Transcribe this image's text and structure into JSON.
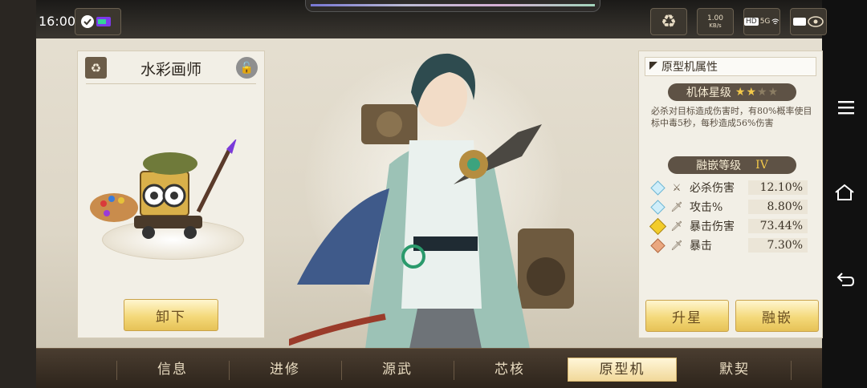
{
  "status": {
    "time": "16:00",
    "speed_value": "1.00",
    "speed_unit": "KB/s",
    "hd": "HD",
    "net": "5G"
  },
  "colors": {
    "accent_gold": "#f4d97a",
    "panel_bg": "#f2efe6",
    "bar_bg": "#2d241b",
    "gem_blue": "#bfe7f5",
    "gem_gold": "#f2cc2a",
    "gem_orange": "#e8a07a"
  },
  "left_panel": {
    "title": "水彩画师",
    "unequip_label": "卸下"
  },
  "right_panel": {
    "header": "原型机属性",
    "star_label": "机体星级",
    "stars": {
      "filled": 2,
      "total": 4
    },
    "skill_desc": "必杀对目标造成伤害时，有80%概率使目标中毒5秒，每秒造成56%伤害",
    "inlay_label": "融嵌等级",
    "inlay_level": "IV",
    "attributes": [
      {
        "icon": "swords-icon",
        "gem": "blue",
        "name": "必杀伤害",
        "value": "12.10%"
      },
      {
        "icon": "sword-icon",
        "gem": "blue",
        "name": "攻击%",
        "value": "8.80%"
      },
      {
        "icon": "crit-sword-icon",
        "gem": "gold",
        "name": "暴击伤害",
        "value": "73.44%"
      },
      {
        "icon": "crit-sword-icon",
        "gem": "orange",
        "name": "暴击",
        "value": "7.30%"
      }
    ],
    "upstar_label": "升星",
    "inlay_btn_label": "融嵌"
  },
  "tabs": [
    {
      "label": "信息",
      "active": false
    },
    {
      "label": "进修",
      "active": false
    },
    {
      "label": "源武",
      "active": false
    },
    {
      "label": "芯核",
      "active": false
    },
    {
      "label": "原型机",
      "active": true
    },
    {
      "label": "默契",
      "active": false
    }
  ]
}
